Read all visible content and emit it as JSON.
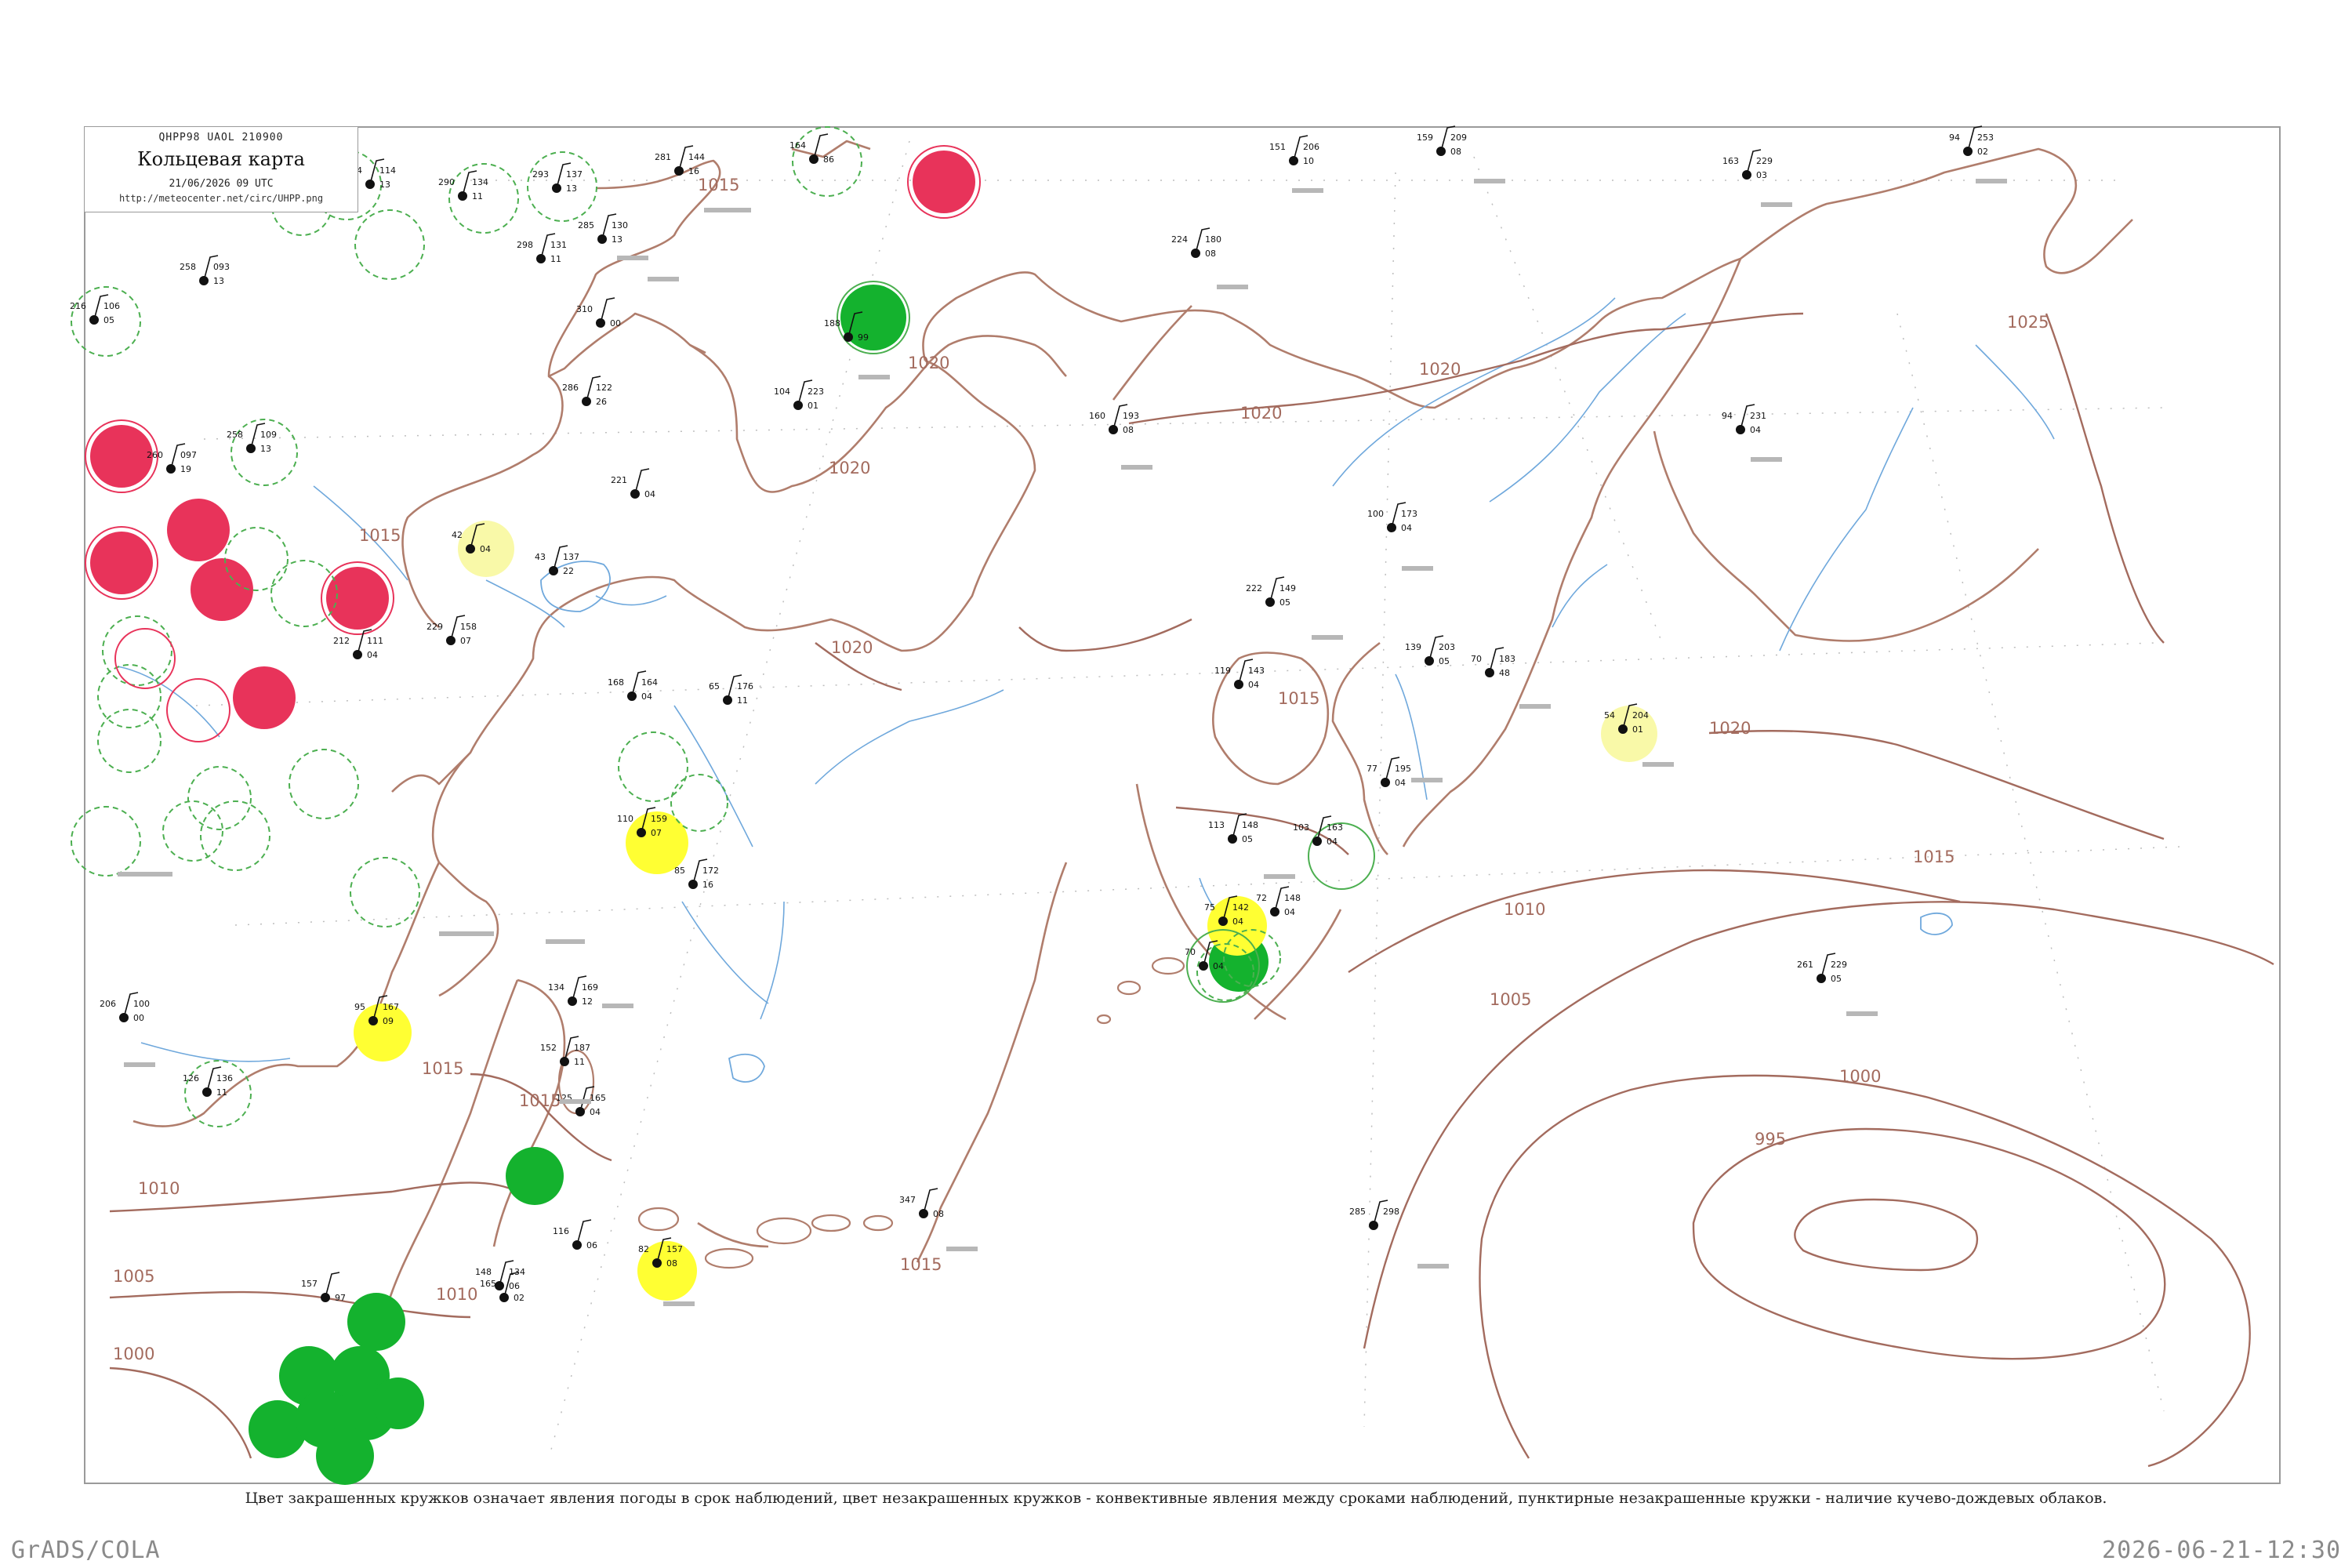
{
  "header": {
    "code": "QHPP98 UAOL 210900",
    "title": "Кольцевая карта",
    "datetime": "21/06/2026 09 UTC",
    "url": "http://meteocenter.net/circ/UHPP.png"
  },
  "caption": "Цвет закрашенных кружков означает явления погоды в срок наблюдений, цвет незакрашенных кружков - конвективные явления между сроками наблюдений, пунктирные незакрашенные кружки - наличие кучево-дождевых облаков.",
  "footer": {
    "left": "GrADS/COLA",
    "right": "2026-06-21-12:30"
  },
  "isobar_labels": [
    "1025",
    "1020",
    "1020",
    "1020",
    "1020",
    "1020",
    "1020",
    "1015",
    "1015",
    "1015",
    "1015",
    "1015",
    "1015",
    "1010",
    "1010",
    "1010",
    "1005",
    "1005",
    "1000",
    "1000",
    "995",
    "1015"
  ],
  "stations": [
    {
      "p": "294",
      "t": "114",
      "v": "13"
    },
    {
      "p": "290",
      "t": "134",
      "v": "11"
    },
    {
      "p": "293",
      "t": "137",
      "v": "13"
    },
    {
      "p": "164",
      "t": "",
      "v": "86"
    },
    {
      "p": "281",
      "t": "144",
      "v": "16"
    },
    {
      "p": "151",
      "t": "206",
      "v": "10"
    },
    {
      "p": "159",
      "t": "209",
      "v": "08"
    },
    {
      "p": "163",
      "t": "229",
      "v": "03"
    },
    {
      "p": "94",
      "t": "253",
      "v": "02"
    },
    {
      "p": "216",
      "t": "106",
      "v": "05"
    },
    {
      "p": "258",
      "t": "093",
      "v": "13"
    },
    {
      "p": "298",
      "t": "131",
      "v": "11"
    },
    {
      "p": "285",
      "t": "130",
      "v": "13"
    },
    {
      "p": "224",
      "t": "180",
      "v": "08"
    },
    {
      "p": "310",
      "t": "",
      "v": "00"
    },
    {
      "p": "188",
      "t": "",
      "v": "99"
    },
    {
      "p": "104",
      "t": "223",
      "v": "01"
    },
    {
      "p": "286",
      "t": "122",
      "v": "26"
    },
    {
      "p": "160",
      "t": "193",
      "v": "08"
    },
    {
      "p": "94",
      "t": "231",
      "v": "04"
    },
    {
      "p": "258",
      "t": "109",
      "v": "13"
    },
    {
      "p": "260",
      "t": "097",
      "v": "19"
    },
    {
      "p": "221",
      "t": "",
      "v": "04"
    },
    {
      "p": "100",
      "t": "173",
      "v": "04"
    },
    {
      "p": "42",
      "t": "",
      "v": "04"
    },
    {
      "p": "43",
      "t": "137",
      "v": "22"
    },
    {
      "p": "222",
      "t": "149",
      "v": "05"
    },
    {
      "p": "229",
      "t": "158",
      "v": "07"
    },
    {
      "p": "212",
      "t": "111",
      "v": "04"
    },
    {
      "p": "119",
      "t": "143",
      "v": "04"
    },
    {
      "p": "139",
      "t": "203",
      "v": "05"
    },
    {
      "p": "70",
      "t": "183",
      "v": "48"
    },
    {
      "p": "168",
      "t": "164",
      "v": "04"
    },
    {
      "p": "65",
      "t": "176",
      "v": "11"
    },
    {
      "p": "54",
      "t": "204",
      "v": "01"
    },
    {
      "p": "77",
      "t": "195",
      "v": "04"
    },
    {
      "p": "110",
      "t": "159",
      "v": "07"
    },
    {
      "p": "113",
      "t": "148",
      "v": "05"
    },
    {
      "p": "103",
      "t": "163",
      "v": "04"
    },
    {
      "p": "85",
      "t": "172",
      "v": "16"
    },
    {
      "p": "72",
      "t": "148",
      "v": "04"
    },
    {
      "p": "261",
      "t": "229",
      "v": "05"
    },
    {
      "p": "75",
      "t": "142",
      "v": "04"
    },
    {
      "p": "70",
      "t": "",
      "v": "04"
    },
    {
      "p": "95",
      "t": "167",
      "v": "09"
    },
    {
      "p": "126",
      "t": "136",
      "v": "11"
    },
    {
      "p": "206",
      "t": "100",
      "v": "00"
    },
    {
      "p": "134",
      "t": "169",
      "v": "12"
    },
    {
      "p": "152",
      "t": "187",
      "v": "11"
    },
    {
      "p": "125",
      "t": "165",
      "v": "04"
    },
    {
      "p": "347",
      "t": "",
      "v": "08"
    },
    {
      "p": "285",
      "t": "298",
      "v": ""
    },
    {
      "p": "82",
      "t": "157",
      "v": "08"
    },
    {
      "p": "116",
      "t": "",
      "v": "06"
    },
    {
      "p": "148",
      "t": "134",
      "v": "06"
    },
    {
      "p": "165",
      "t": "",
      "v": "02"
    },
    {
      "p": "157",
      "t": "",
      "v": "97"
    }
  ]
}
